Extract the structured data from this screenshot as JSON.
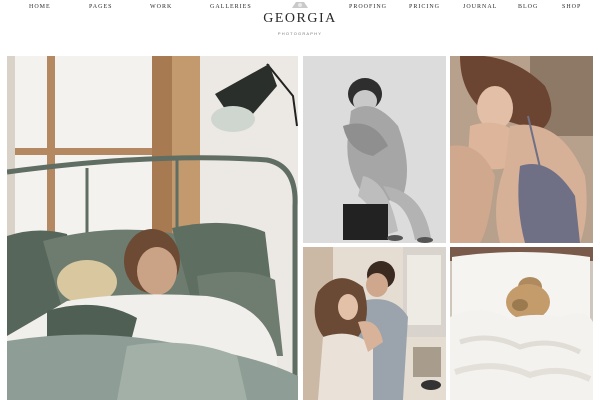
{
  "nav": {
    "left": [
      "HOME",
      "PAGES",
      "WORK",
      "GALLERIES"
    ],
    "right": [
      "PROOFING",
      "PRICING",
      "JOURNAL",
      "BLOG",
      "SHOP"
    ]
  },
  "logo": {
    "title": "GEORGIA",
    "subtitle": "PHOTOGRAPHY",
    "icon": "camera-logo-icon"
  },
  "gallery": {
    "items": [
      {
        "id": "couple-in-bed",
        "tone": "color"
      },
      {
        "id": "woman-sitting-stool",
        "tone": "black-and-white"
      },
      {
        "id": "woman-swimsuit-portrait",
        "tone": "color"
      },
      {
        "id": "couple-embracing-kitchen",
        "tone": "color"
      },
      {
        "id": "woman-under-blanket",
        "tone": "color"
      }
    ]
  },
  "colors": {
    "background": "#ffffff",
    "nav_text": "#2a2a2a",
    "accent_bed_green": "#5b6b5f"
  }
}
